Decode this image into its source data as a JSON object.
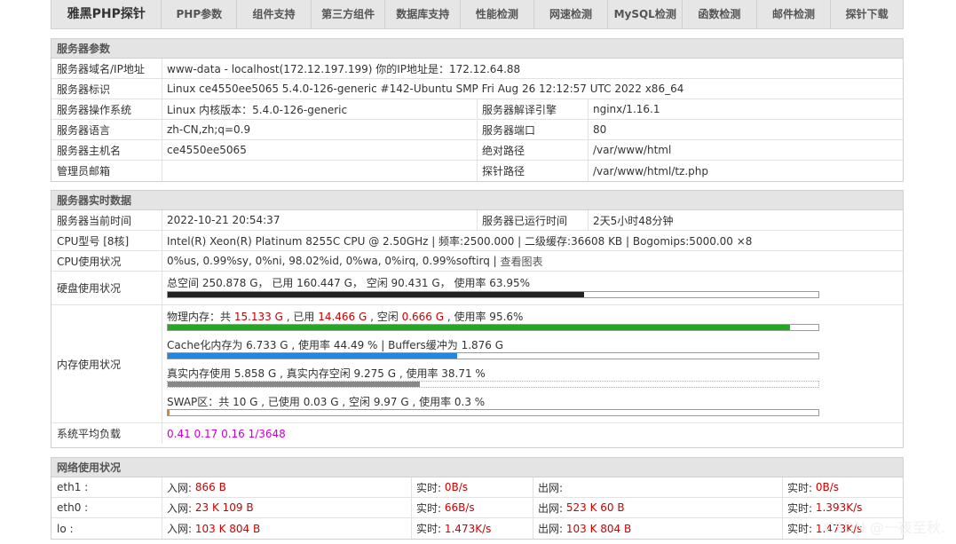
{
  "nav": {
    "brand": "雅黑PHP探针",
    "items": [
      "PHP参数",
      "组件支持",
      "第三方组件",
      "数据库支持",
      "性能检测",
      "网速检测",
      "MySQL检测",
      "函数检测",
      "邮件检测",
      "探针下载"
    ]
  },
  "server": {
    "title": "服务器参数",
    "domain_label": "服务器域名/IP地址",
    "domain_value": "www-data - localhost(172.12.197.199)  你的IP地址是：172.12.64.88",
    "ident_label": "服务器标识",
    "ident_value": "Linux ce4550ee5065 5.4.0-126-generic #142-Ubuntu SMP Fri Aug 26 12:12:57 UTC 2022 x86_64",
    "os_label": "服务器操作系统",
    "os_value": "Linux  内核版本：5.4.0-126-generic",
    "engine_label": "服务器解译引擎",
    "engine_value": "nginx/1.16.1",
    "lang_label": "服务器语言",
    "lang_value": "zh-CN,zh;q=0.9",
    "port_label": "服务器端口",
    "port_value": "80",
    "host_label": "服务器主机名",
    "host_value": "ce4550ee5065",
    "abspath_label": "绝对路径",
    "abspath_value": "/var/www/html",
    "admin_label": "管理员邮箱",
    "admin_value": "",
    "probe_label": "探针路径",
    "probe_value": "/var/www/html/tz.php"
  },
  "realtime": {
    "title": "服务器实时数据",
    "time_label": "服务器当前时间",
    "time_value": "2022-10-21 20:54:37",
    "uptime_label": "服务器已运行时间",
    "uptime_value": "2天5小时48分钟",
    "cpu_label": "CPU型号 [8核]",
    "cpu_value": "Intel(R) Xeon(R) Platinum 8255C CPU @ 2.50GHz | 频率:2500.000 | 二级缓存:36608 KB | Bogomips:5000.00 ×8",
    "cpu_usage_label": "CPU使用状况",
    "cpu_usage_value": "0%us, 0.99%sy, 0%ni, 98.02%id, 0%wa, 0%irq, 0.99%softirq | ",
    "cpu_chart_link": "查看图表",
    "disk_label": "硬盘使用状况",
    "disk_text": "总空间 250.878 G，  已用 160.447 G，  空闲 90.431 G，  使用率 63.95%",
    "disk_usage": 0.6395,
    "mem_label": "内存使用状况",
    "mem": {
      "phys_prefix": "物理内存：共 ",
      "phys_total": "15.133 G",
      "phys_mid1": " , 已用 ",
      "phys_used": "14.466 G",
      "phys_mid2": " , 空闲 ",
      "phys_free": "0.666 G",
      "phys_suffix": " , 使用率 95.6%",
      "phys_usage": 0.956,
      "cache_text": "Cache化内存为 6.733 G , 使用率 44.49 % | Buffers缓冲为 1.876 G",
      "cache_usage": 0.4449,
      "real_text": "真实内存使用 5.858 G , 真实内存空闲 9.275 G , 使用率 38.71 %",
      "real_usage": 0.3871,
      "swap_text": "SWAP区：共 10 G , 已使用 0.03 G , 空闲 9.97 G , 使用率 0.3 %",
      "swap_usage": 0.003
    },
    "load_label": "系统平均负载",
    "load_value": "0.41 0.17 0.16 1/3648"
  },
  "network": {
    "title": "网络使用状况",
    "in_label": "入网: ",
    "out_label": "出网: ",
    "rt_label": "实时: ",
    "rows": [
      {
        "iface": "eth1 :",
        "in": "866 B",
        "in_rt": "0B/s",
        "out": "",
        "out_rt": "0B/s"
      },
      {
        "iface": "eth0 :",
        "in": "23 K 109 B",
        "in_rt": "66B/s",
        "out": "523 K 60 B",
        "out_rt": "1.393K/s"
      },
      {
        "iface": "lo :",
        "in": "103 K 804 B",
        "in_rt": "1.473K/s",
        "out": "103 K 804 B",
        "out_rt": "1.473K/s"
      }
    ]
  },
  "watermark": "CSDN @一夜至秋."
}
